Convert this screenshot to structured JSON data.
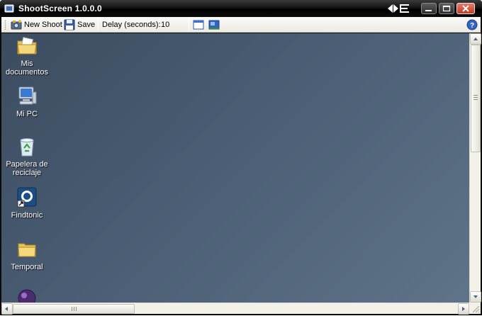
{
  "window": {
    "title": "ShootScreen 1.0.0.0",
    "controls": [
      "minimize",
      "maximize",
      "close"
    ],
    "brand_icon": "arrows-logo-icon"
  },
  "toolbar": {
    "new_shoot_label": "New Shoot",
    "save_label": "Save",
    "delay_label": "Delay (seconds):",
    "delay_value": "10",
    "view_buttons": [
      "window-view-icon",
      "desktop-view-icon"
    ],
    "help_icon": "help-icon"
  },
  "desktop": {
    "icons": [
      {
        "label": "Mis documentos",
        "icon": "folder-documents-icon"
      },
      {
        "label": "Mi PC",
        "icon": "computer-icon"
      },
      {
        "label": "Papelera de reciclaje",
        "icon": "recycle-bin-icon"
      },
      {
        "label": "Findtonic",
        "icon": "findtonic-icon"
      },
      {
        "label": "Temporal",
        "icon": "folder-icon"
      },
      {
        "label": "",
        "icon": "partial-icon"
      }
    ]
  },
  "colors": {
    "titlebar": "#000000",
    "desktop": "#4a5d74",
    "close_button": "#c23b22"
  }
}
